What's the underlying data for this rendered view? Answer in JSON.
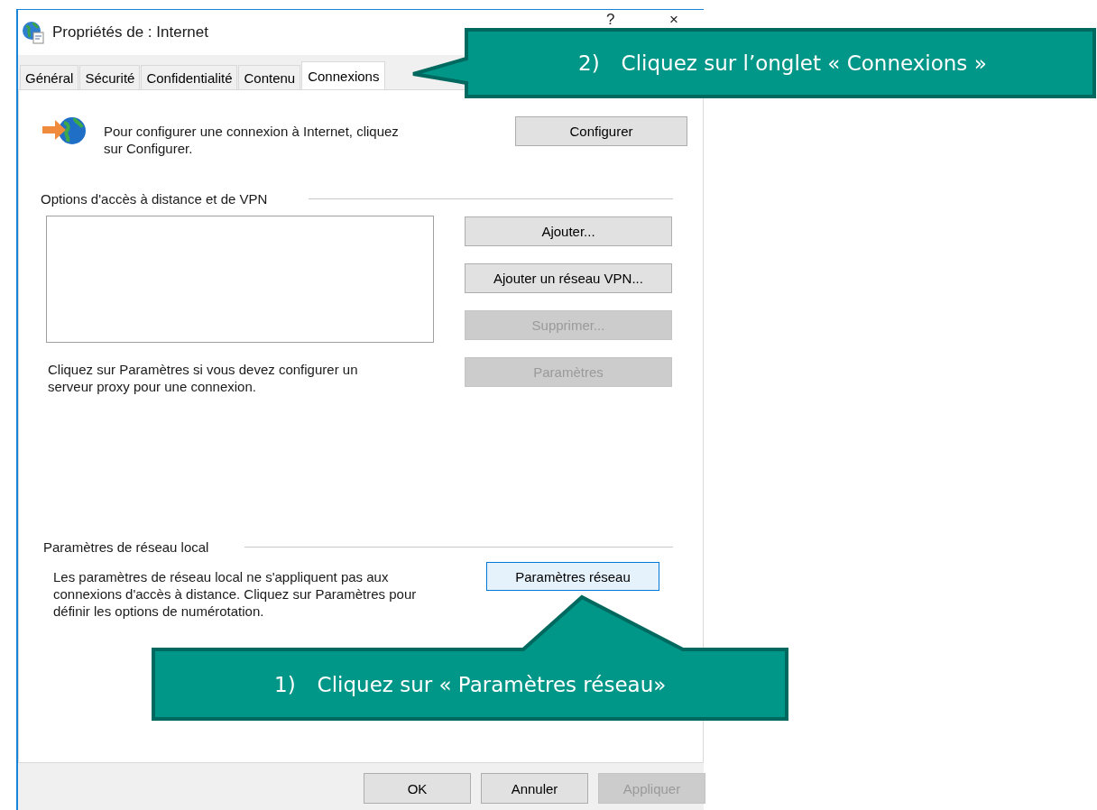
{
  "window": {
    "title": "Propriétés de : Internet",
    "help_button": "?",
    "close_button": "×"
  },
  "tabs": [
    {
      "label": "Général",
      "selected": false
    },
    {
      "label": "Sécurité",
      "selected": false
    },
    {
      "label": "Confidentialité",
      "selected": false
    },
    {
      "label": "Contenu",
      "selected": false
    },
    {
      "label": "Connexions",
      "selected": true
    }
  ],
  "setup": {
    "text": "Pour configurer une connexion à Internet, cliquez sur Configurer.",
    "button": "Configurer"
  },
  "vpn": {
    "heading": "Options d'accès à distance et de VPN",
    "buttons": [
      {
        "label": "Ajouter...",
        "disabled": false
      },
      {
        "label": "Ajouter un réseau VPN...",
        "disabled": false
      },
      {
        "label": "Supprimer...",
        "disabled": true
      },
      {
        "label": "Paramètres",
        "disabled": true
      }
    ],
    "proxy_text": "Cliquez sur Paramètres si vous devez configurer un serveur proxy pour une connexion."
  },
  "lan": {
    "heading": "Paramètres de réseau local",
    "text": "Les paramètres de réseau local ne s'appliquent pas aux connexions d'accès à distance. Cliquez sur Paramètres pour définir les options de numérotation.",
    "button": {
      "label": "Paramètres réseau",
      "focused": true
    }
  },
  "footer_buttons": [
    {
      "label": "OK",
      "disabled": false
    },
    {
      "label": "Annuler",
      "disabled": false
    },
    {
      "label": "Appliquer",
      "disabled": true
    }
  ],
  "callouts": [
    {
      "number": "2)",
      "text": "Cliquez sur l’onglet « Connexions »",
      "kind": "left"
    },
    {
      "number": "1)",
      "text": "Cliquez sur « Paramètres réseau»",
      "kind": "up"
    }
  ]
}
